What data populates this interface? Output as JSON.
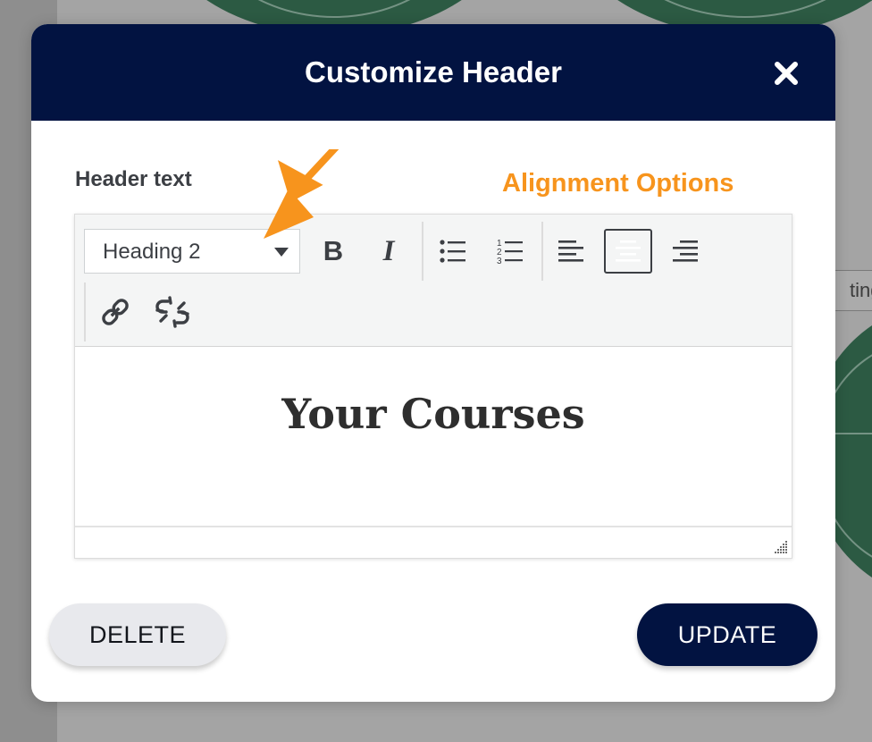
{
  "background": {
    "chip_text": "ting"
  },
  "modal": {
    "title": "Customize Header",
    "close_icon": "close-icon",
    "field_label": "Header text",
    "annotation": "Alignment Options",
    "annotation_color": "#f7941d"
  },
  "toolbar": {
    "format_select": {
      "selected": "Heading 2"
    },
    "buttons": [
      {
        "icon": "bold-icon"
      },
      {
        "icon": "italic-icon"
      },
      {
        "icon": "bulleted-list-icon"
      },
      {
        "icon": "numbered-list-icon"
      },
      {
        "icon": "align-left-icon"
      },
      {
        "icon": "align-center-icon",
        "active": true
      },
      {
        "icon": "align-right-icon"
      },
      {
        "icon": "link-icon"
      },
      {
        "icon": "unlink-icon"
      }
    ],
    "bold_label": "B",
    "italic_label": "I"
  },
  "editor": {
    "content_heading": "Your Courses"
  },
  "footer": {
    "delete_label": "DELETE",
    "update_label": "UPDATE"
  },
  "colors": {
    "header_bg": "#021341",
    "update_bg": "#021341",
    "delete_bg": "#e8e9ed",
    "accent_orange": "#f7941d"
  }
}
